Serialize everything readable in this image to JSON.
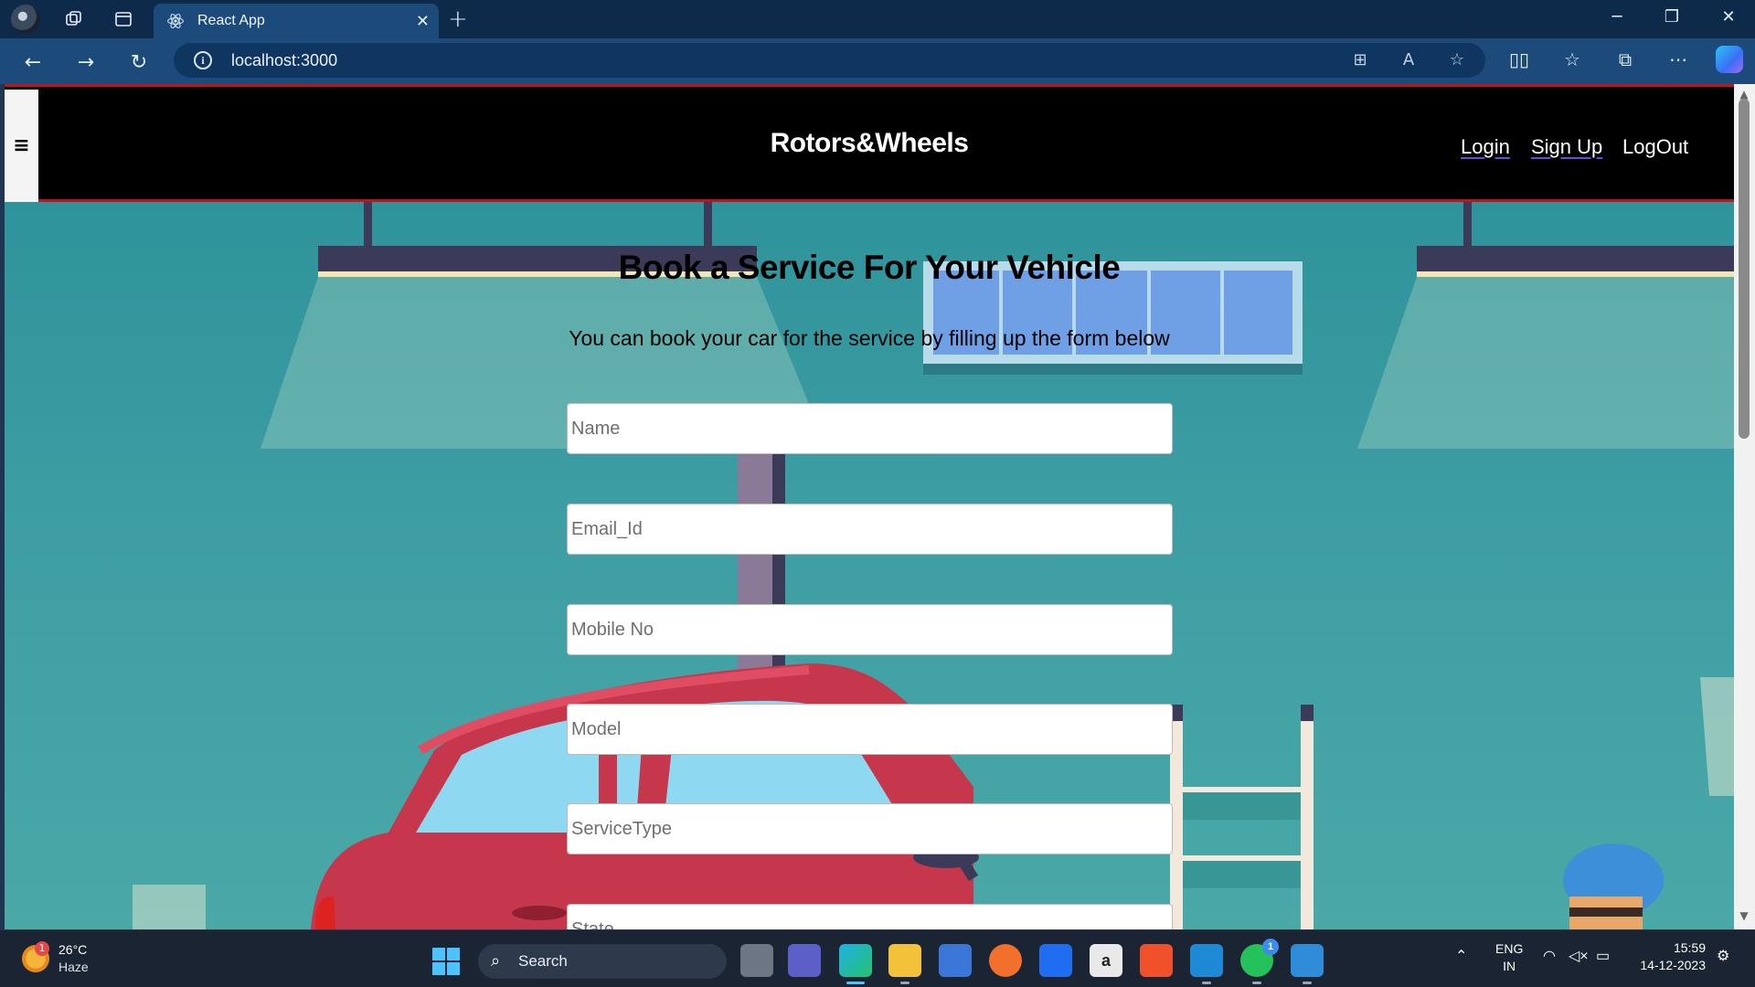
{
  "browser": {
    "tab_title": "React App",
    "url": "localhost:3000"
  },
  "navbar": {
    "brand": "Rotors&Wheels",
    "links": [
      "Login",
      "Sign Up",
      "LogOut"
    ]
  },
  "form": {
    "heading": "Book a Service For Your Vehicle",
    "subheading": "You can book your car for the service by filling up the form below",
    "fields": [
      {
        "placeholder": "Name"
      },
      {
        "placeholder": "Email_Id"
      },
      {
        "placeholder": "Mobile No"
      },
      {
        "placeholder": "Model"
      },
      {
        "placeholder": "ServiceType"
      },
      {
        "placeholder": "State"
      }
    ]
  },
  "taskbar": {
    "weather_temp": "26°C",
    "weather_condition": "Haze",
    "weather_badge": "1",
    "search_label": "Search",
    "language": "ENG",
    "region": "IN",
    "time": "15:59",
    "date": "14-12-2023",
    "whatsapp_badge": "1"
  },
  "icons": {
    "page_scene": "garage-illustration"
  },
  "colors": {
    "accent_red": "#c0141c",
    "scene_teal": "#3a9ba0"
  }
}
